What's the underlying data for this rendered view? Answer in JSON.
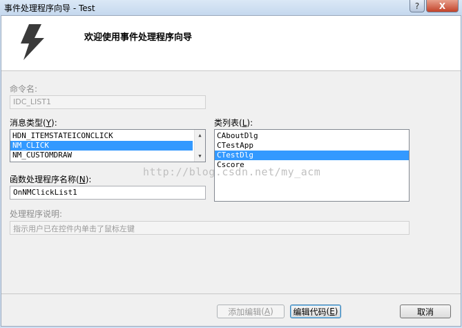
{
  "window": {
    "title": "事件处理程序向导 - Test",
    "help_label": "?",
    "close_label": "X"
  },
  "header": {
    "title": "欢迎使用事件处理程序向导"
  },
  "command_name": {
    "label": "命令名:",
    "value": "IDC_LIST1"
  },
  "message_type": {
    "label": "消息类型",
    "hotkey": "Y",
    "items": [
      "HDN_ITEMSTATEICONCLICK",
      "NM_CLICK",
      "NM_CUSTOMDRAW"
    ]
  },
  "class_list": {
    "label": "类列表",
    "hotkey": "L",
    "items": [
      "CAboutDlg",
      "CTestApp",
      "CTestDlg",
      "Cscore"
    ]
  },
  "handler_name": {
    "label": "函数处理程序名称",
    "hotkey": "N",
    "value": "OnNMClickList1"
  },
  "description": {
    "label": "处理程序说明:",
    "value": "指示用户已在控件内单击了鼠标左键"
  },
  "watermark": "http://blog.csdn.net/my_acm",
  "buttons": {
    "add_edit": "添加编辑",
    "add_edit_hotkey": "A",
    "edit_code": "编辑代码",
    "edit_code_hotkey": "E",
    "cancel": "取消"
  }
}
